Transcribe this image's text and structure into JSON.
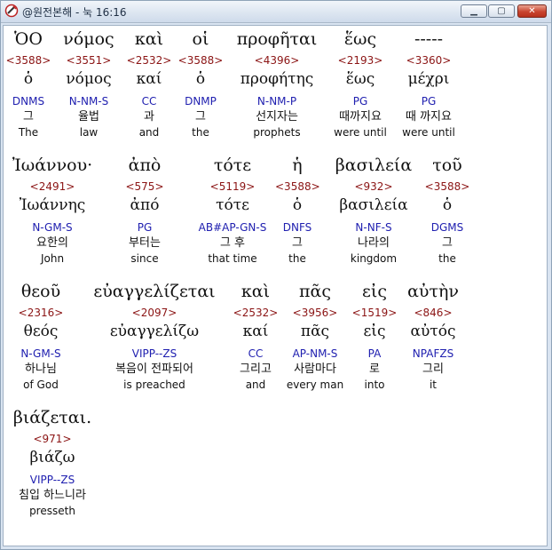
{
  "window": {
    "title": "@원전본해 - 눅 16:16"
  },
  "rows": [
    [
      {
        "greek": "ὉΟ",
        "strong": "<3588>",
        "lemma": "ὁ",
        "parse": "DNMS",
        "kor": "그",
        "eng": "The"
      },
      {
        "greek": "νόμος",
        "strong": "<3551>",
        "lemma": "νόμος",
        "parse": "N-NM-S",
        "kor": "율법",
        "eng": "law"
      },
      {
        "greek": "καὶ",
        "strong": "<2532>",
        "lemma": "καί",
        "parse": "CC",
        "kor": "과",
        "eng": "and"
      },
      {
        "greek": "οἱ",
        "strong": "<3588>",
        "lemma": "ὁ",
        "parse": "DNMP",
        "kor": "그",
        "eng": "the"
      },
      {
        "greek": "προφῆται",
        "strong": "<4396>",
        "lemma": "προφήτης",
        "parse": "N-NM-P",
        "kor": "선지자는",
        "eng": "prophets"
      },
      {
        "greek": "ἕως",
        "strong": "<2193>",
        "lemma": "ἕως",
        "parse": "PG",
        "kor": "때까지요",
        "eng": "were until"
      },
      {
        "greek": "-----",
        "strong": "<3360>",
        "lemma": "μέχρι",
        "parse": "PG",
        "kor": "때 까지요",
        "eng": "were until"
      }
    ],
    [
      {
        "greek": "Ἰωάννου·",
        "strong": "<2491>",
        "lemma": "Ἰωάννης",
        "parse": "N-GM-S",
        "kor": "요한의",
        "eng": "John"
      },
      {
        "greek": "ἀπὸ",
        "strong": "<575>",
        "lemma": "ἀπό",
        "parse": "PG",
        "kor": "부터는",
        "eng": "since"
      },
      {
        "greek": "τότε",
        "strong": "<5119>",
        "lemma": "τότε",
        "parse": "AB#AP-GN-S",
        "kor": "그 후",
        "eng": "that time"
      },
      {
        "greek": "ἡ",
        "strong": "<3588>",
        "lemma": "ὁ",
        "parse": "DNFS",
        "kor": "그",
        "eng": "the"
      },
      {
        "greek": "βασιλεία",
        "strong": "<932>",
        "lemma": "βασιλεία",
        "parse": "N-NF-S",
        "kor": "나라의",
        "eng": "kingdom"
      },
      {
        "greek": "τοῦ",
        "strong": "<3588>",
        "lemma": "ὁ",
        "parse": "DGMS",
        "kor": "그",
        "eng": "the"
      }
    ],
    [
      {
        "greek": "θεοῦ",
        "strong": "<2316>",
        "lemma": "θεός",
        "parse": "N-GM-S",
        "kor": "하나님",
        "eng": "of God"
      },
      {
        "greek": "εὐαγγελίζεται",
        "strong": "<2097>",
        "lemma": "εὐαγγελίζω",
        "parse": "VIPP--ZS",
        "kor": "복음이 전파되어",
        "eng": "is preached"
      },
      {
        "greek": "καὶ",
        "strong": "<2532>",
        "lemma": "καί",
        "parse": "CC",
        "kor": "그리고",
        "eng": "and"
      },
      {
        "greek": "πᾶς",
        "strong": "<3956>",
        "lemma": "πᾶς",
        "parse": "AP-NM-S",
        "kor": "사람마다",
        "eng": "every man"
      },
      {
        "greek": "εἰς",
        "strong": "<1519>",
        "lemma": "εἰς",
        "parse": "PA",
        "kor": "로",
        "eng": "into"
      },
      {
        "greek": "αὐτὴν",
        "strong": "<846>",
        "lemma": "αὐτός",
        "parse": "NPAFZS",
        "kor": "그리",
        "eng": "it"
      }
    ],
    [
      {
        "greek": "βιάζεται.",
        "strong": "<971>",
        "lemma": "βιάζω",
        "parse": "VIPP--ZS",
        "kor": "침입 하느니라",
        "eng": "presseth"
      }
    ]
  ]
}
